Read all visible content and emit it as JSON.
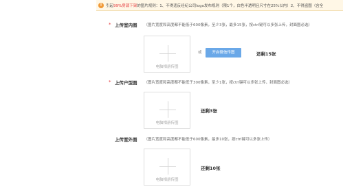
{
  "notice": {
    "prefix": "引起",
    "highlight": "99%房源下架",
    "suffix": "的图片规则：1、不得违反经纪公司logo发布规则（限1个，白色半透明且尺寸在25%以内）2、不得盗图（含全"
  },
  "sections": [
    {
      "required_mark": "*",
      "label": "上传室内图",
      "hint": "（图片宽度和高度都不能低于600像素，至少3张，最多15张，按ctrl键可以多张上传，封面图必选）",
      "upload_box_label": "电脑相册传图",
      "or_text": "或",
      "wechat_button": "开启微信传图",
      "remaining": "还剩15张"
    },
    {
      "required_mark": "*",
      "label": "上传户型图",
      "hint": "（图片宽度和高度都不能低于300像素，至少1张，按ctrl键可以多张上传，封面图必选）",
      "upload_box_label": "电脑相册传图",
      "remaining": "还剩3张"
    },
    {
      "required_mark": "",
      "label": "上传室外图",
      "hint": "（图片宽度和高度都不能低于600像素，最多10张，按ctrl键可以多张上传）",
      "upload_box_label": "电脑相册传图",
      "remaining": "还剩10张"
    }
  ],
  "colors": {
    "required": "#e4393c",
    "button": "#6aa8e8",
    "notice_bg": "#fff7e6",
    "warn_icon": "#f19a38"
  }
}
